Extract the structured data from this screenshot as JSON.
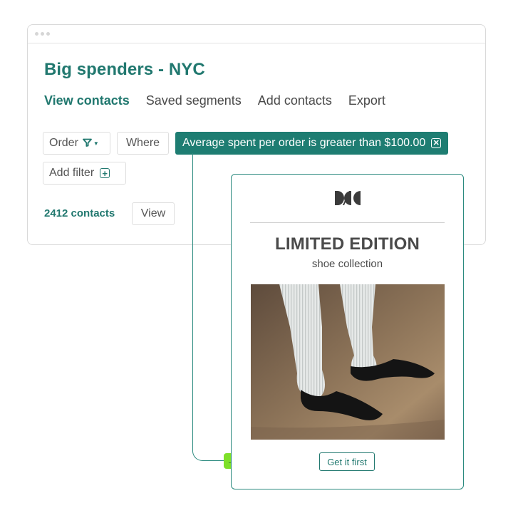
{
  "window": {
    "title": "Big spenders - NYC",
    "tabs": [
      {
        "label": "View contacts",
        "active": true
      },
      {
        "label": "Saved segments",
        "active": false
      },
      {
        "label": "Add contacts",
        "active": false
      },
      {
        "label": "Export",
        "active": false
      }
    ],
    "filters": {
      "order_label": "Order",
      "order_icon": "funnel-icon",
      "where_label": "Where",
      "condition": "Average spent per order is greater than $100.00",
      "remove_icon": "close-box-icon",
      "add_filter_label": "Add filter",
      "add_icon": "plus-box-icon"
    },
    "contacts_count": "2412 contacts",
    "view_label": "View"
  },
  "email_preview": {
    "logo_icon": "brand-logo-icon",
    "headline": "LIMITED EDITION",
    "subhead": "shoe collection",
    "image": "model-legs-black-pointed-shoes",
    "cta_label": "Get it first"
  },
  "connector": {
    "icon": "arrow-right-icon",
    "accent": "#7ee029"
  },
  "colors": {
    "brand": "#21786f",
    "pill": "#1e7d72"
  }
}
